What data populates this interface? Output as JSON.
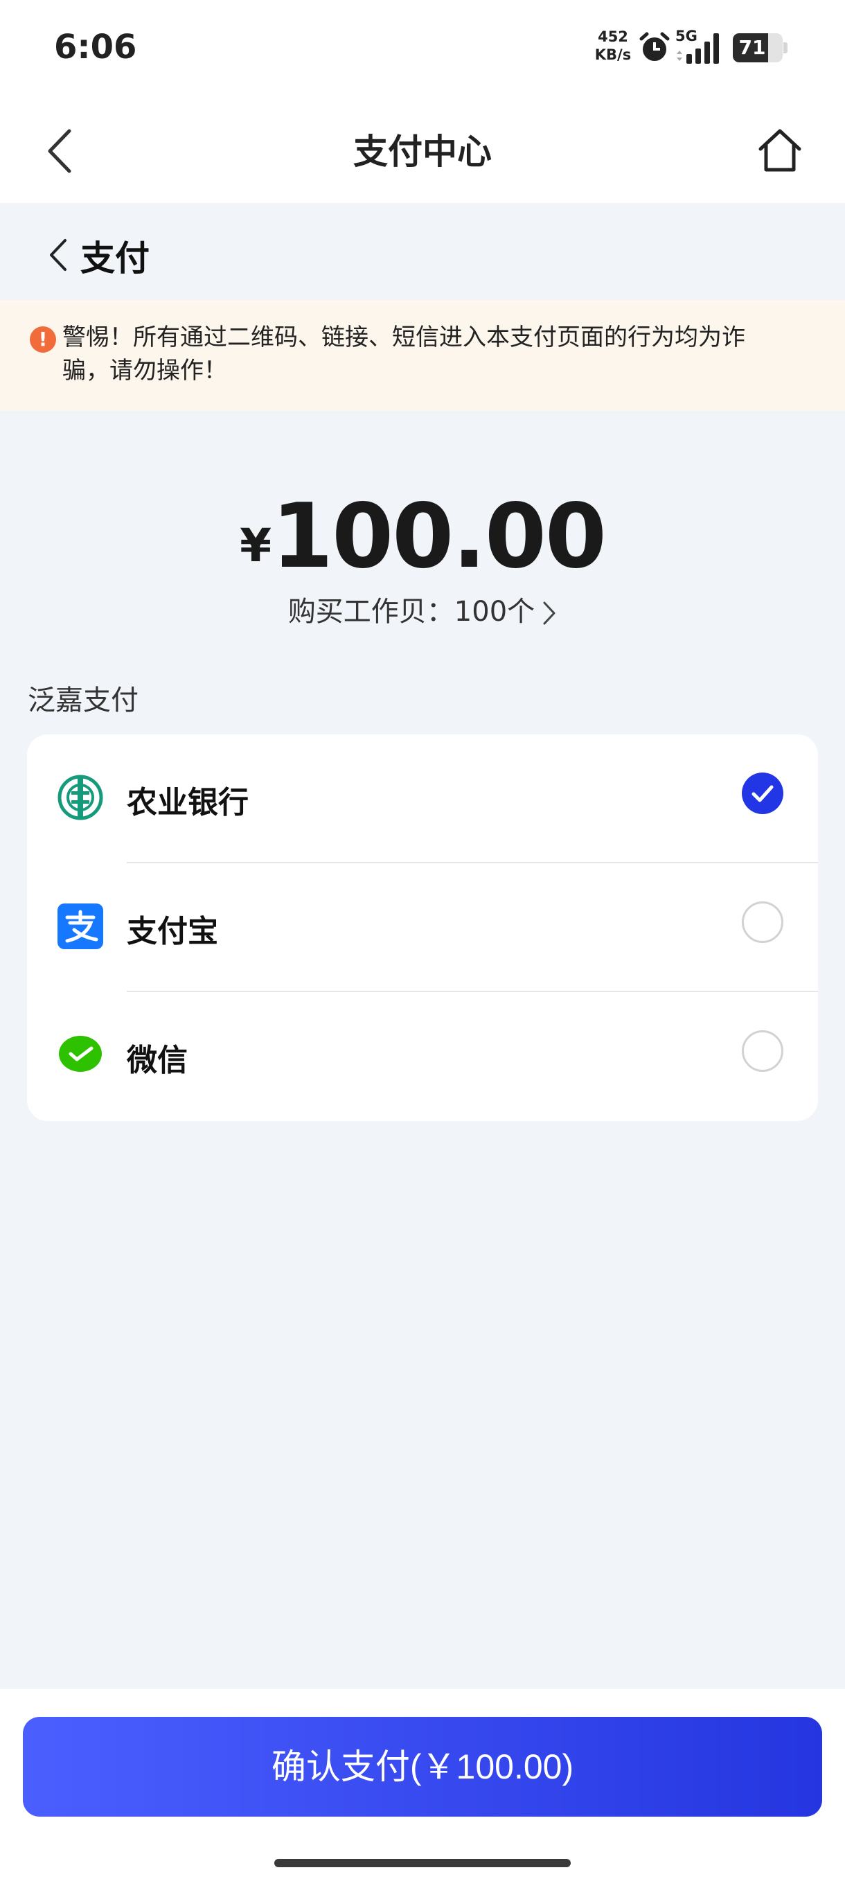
{
  "status_bar": {
    "time": "6:06",
    "net_speed_value": "452",
    "net_speed_unit": "KB/s",
    "network": "5G",
    "battery": "71",
    "battery_level": 0.71
  },
  "nav": {
    "title": "支付中心"
  },
  "sub_header": {
    "title": "支付"
  },
  "warning": {
    "text": "警惕！所有通过二维码、链接、短信进入本支付页面的行为均为诈骗，请勿操作！"
  },
  "amount": {
    "currency": "¥",
    "value": "100.00",
    "purchase": "购买工作贝：100个"
  },
  "payment": {
    "section_label": "泛嘉支付",
    "methods": [
      {
        "label": "农业银行",
        "selected": true,
        "icon": "abc-bank-icon"
      },
      {
        "label": "支付宝",
        "selected": false,
        "icon": "alipay-icon"
      },
      {
        "label": "微信",
        "selected": false,
        "icon": "wechat-icon"
      }
    ]
  },
  "confirm": {
    "label": "确认支付(￥100.00)"
  },
  "colors": {
    "accent": "#2236e6",
    "warning_bg": "#fdf6ec",
    "warning_icon": "#f26b3a",
    "page_bg": "#f1f4f9"
  }
}
